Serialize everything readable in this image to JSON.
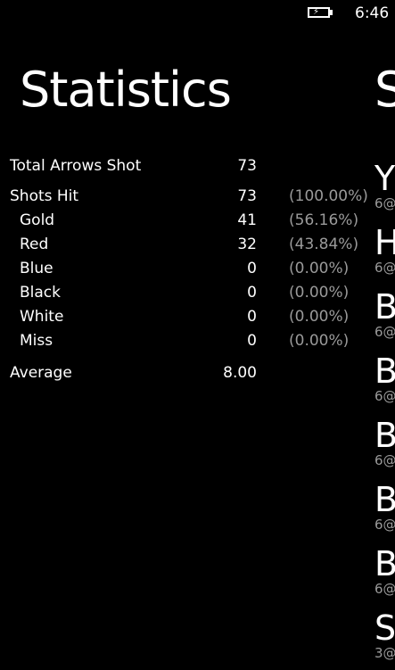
{
  "status_bar": {
    "time": "6:46",
    "battery_icon": "battery-charging-icon"
  },
  "page": {
    "title": "Statistics",
    "next_panel_title_peek": "S"
  },
  "stats": {
    "total": {
      "label": "Total Arrows Shot",
      "value": "73"
    },
    "hit": {
      "label": "Shots Hit",
      "value": "73",
      "pct": "(100.00%)"
    },
    "colors": [
      {
        "label": "Gold",
        "value": "41",
        "pct": "(56.16%)"
      },
      {
        "label": "Red",
        "value": "32",
        "pct": "(43.84%)"
      },
      {
        "label": "Blue",
        "value": "0",
        "pct": "(0.00%)"
      },
      {
        "label": "Black",
        "value": "0",
        "pct": "(0.00%)"
      },
      {
        "label": "White",
        "value": "0",
        "pct": "(0.00%)"
      },
      {
        "label": "Miss",
        "value": "0",
        "pct": "(0.00%)"
      }
    ],
    "average": {
      "label": "Average",
      "value": "8.00"
    }
  },
  "peek_list": [
    {
      "name": "Y",
      "sub": "6@"
    },
    {
      "name": "H",
      "sub": "6@"
    },
    {
      "name": "B",
      "sub": "6@"
    },
    {
      "name": "B",
      "sub": "6@"
    },
    {
      "name": "B",
      "sub": "6@"
    },
    {
      "name": "B",
      "sub": "6@"
    },
    {
      "name": "B",
      "sub": "6@"
    },
    {
      "name": "S",
      "sub": "3@"
    }
  ]
}
